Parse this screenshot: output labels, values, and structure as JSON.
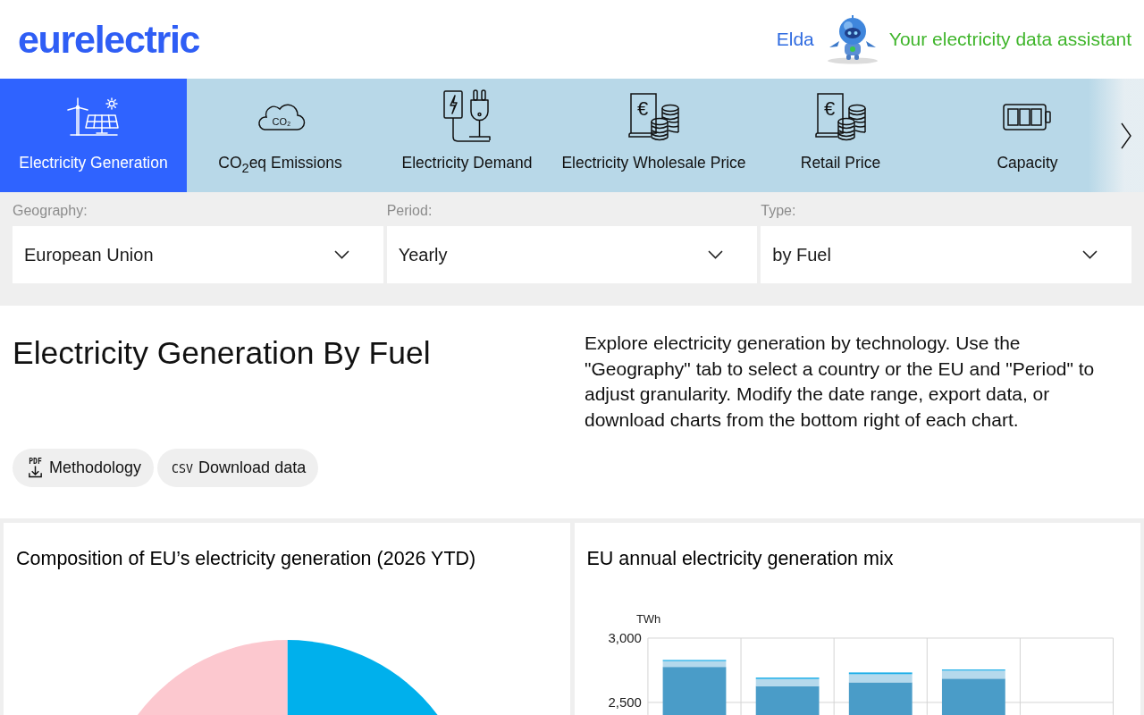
{
  "header": {
    "logo": "eurelectric",
    "assistant_name": "Elda",
    "assistant_tagline": "Your electricity data assistant"
  },
  "tabs": [
    {
      "label": "Electricity Generation",
      "selected": true
    },
    {
      "label": "CO$_{2}$eq Emissions",
      "selected": false,
      "icon_text": "CO₂"
    },
    {
      "label": "Electricity Demand",
      "selected": false
    },
    {
      "label": "Electricity Wholesale Price",
      "selected": false,
      "icon_text": "€"
    },
    {
      "label": "Retail Price",
      "selected": false,
      "icon_text": "€"
    },
    {
      "label": "Capacity",
      "selected": false
    }
  ],
  "filters": [
    {
      "label": "Geography:",
      "value": "European Union"
    },
    {
      "label": "Period:",
      "value": "Yearly"
    },
    {
      "label": "Type:",
      "value": "by Fuel"
    }
  ],
  "intro": {
    "title": "Electricity Generation By Fuel",
    "description": "Explore electricity generation by technology. Use the \"Geography\" tab to select a country or the EU and \"Period\" to adjust granularity. Modify the date range, export data, or download charts from the bottom right of each chart.",
    "buttons": [
      {
        "label": "Methodology",
        "icon_text": "PDF"
      },
      {
        "label": "Download data",
        "icon_text": "CSV"
      }
    ]
  },
  "cards": [
    {
      "kind": "picture",
      "title": "Composition of EU’s electricity generation (2026 YTD)"
    },
    {
      "kind": "chart",
      "chart_data": {
        "type": "bar",
        "title": "EU annual electricity generation mix",
        "ylabel": "TWh",
        "stacked": true,
        "ylim": [
          0,
          3000
        ],
        "yticks": [
          {
            "value": 3000,
            "label": "3,000"
          },
          {
            "value": 2500,
            "label": "2,500"
          }
        ],
        "series": [
          {
            "color": "#4a9cc8",
            "values": [
              2776,
              2627,
              2656,
              2685,
              null
            ]
          },
          {
            "color": "#b5d9ec",
            "values": [
              45,
              55,
              63,
              62,
              null
            ]
          },
          {
            "color": "#1eaee8",
            "values": [
              9,
              11,
              14,
              9,
              null
            ]
          }
        ]
      }
    }
  ]
}
